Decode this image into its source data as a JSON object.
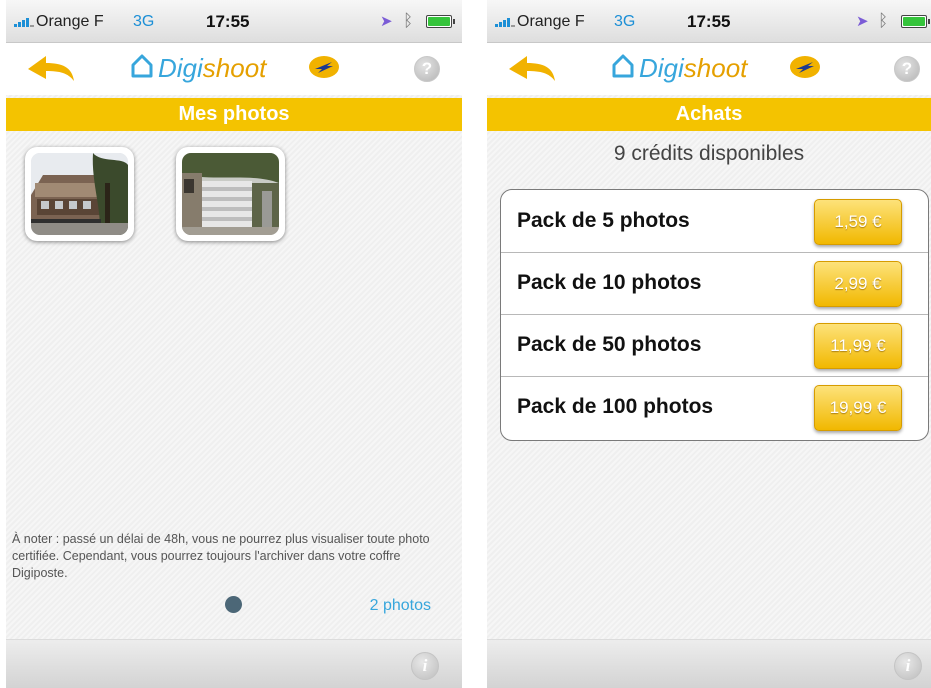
{
  "status_left": {
    "carrier": "Orange F",
    "network": "3G",
    "time": "17:55"
  },
  "status_right": {
    "carrier": "Orange F",
    "network": "3G",
    "time": "17:55"
  },
  "logo": {
    "digi": "Digi",
    "shoot": "shoot"
  },
  "header": {
    "help_glyph": "?",
    "back_icon": "back-arrow-icon"
  },
  "left_screen": {
    "title": "Mes photos",
    "photos": [
      {
        "name": "photo-building"
      },
      {
        "name": "photo-gate"
      }
    ],
    "note": "À noter : passé un délai de 48h, vous ne pourrez plus visualiser toute photo certifiée. Cependant, vous pourrez toujours l'archiver dans votre coffre Digiposte.",
    "count": "2 photos"
  },
  "right_screen": {
    "title": "Achats",
    "credits": "9 crédits disponibles",
    "packs": [
      {
        "label": "Pack de 5 photos",
        "price": "1,59 €"
      },
      {
        "label": "Pack de 10 photos",
        "price": "2,99 €"
      },
      {
        "label": "Pack de 50 photos",
        "price": "11,99 €"
      },
      {
        "label": "Pack de 100 photos",
        "price": "19,99 €"
      }
    ]
  },
  "footer": {
    "info_glyph": "i"
  },
  "colors": {
    "accent_yellow": "#f4c300",
    "link_blue": "#37a6dc",
    "page_dot": "#4c6777"
  }
}
